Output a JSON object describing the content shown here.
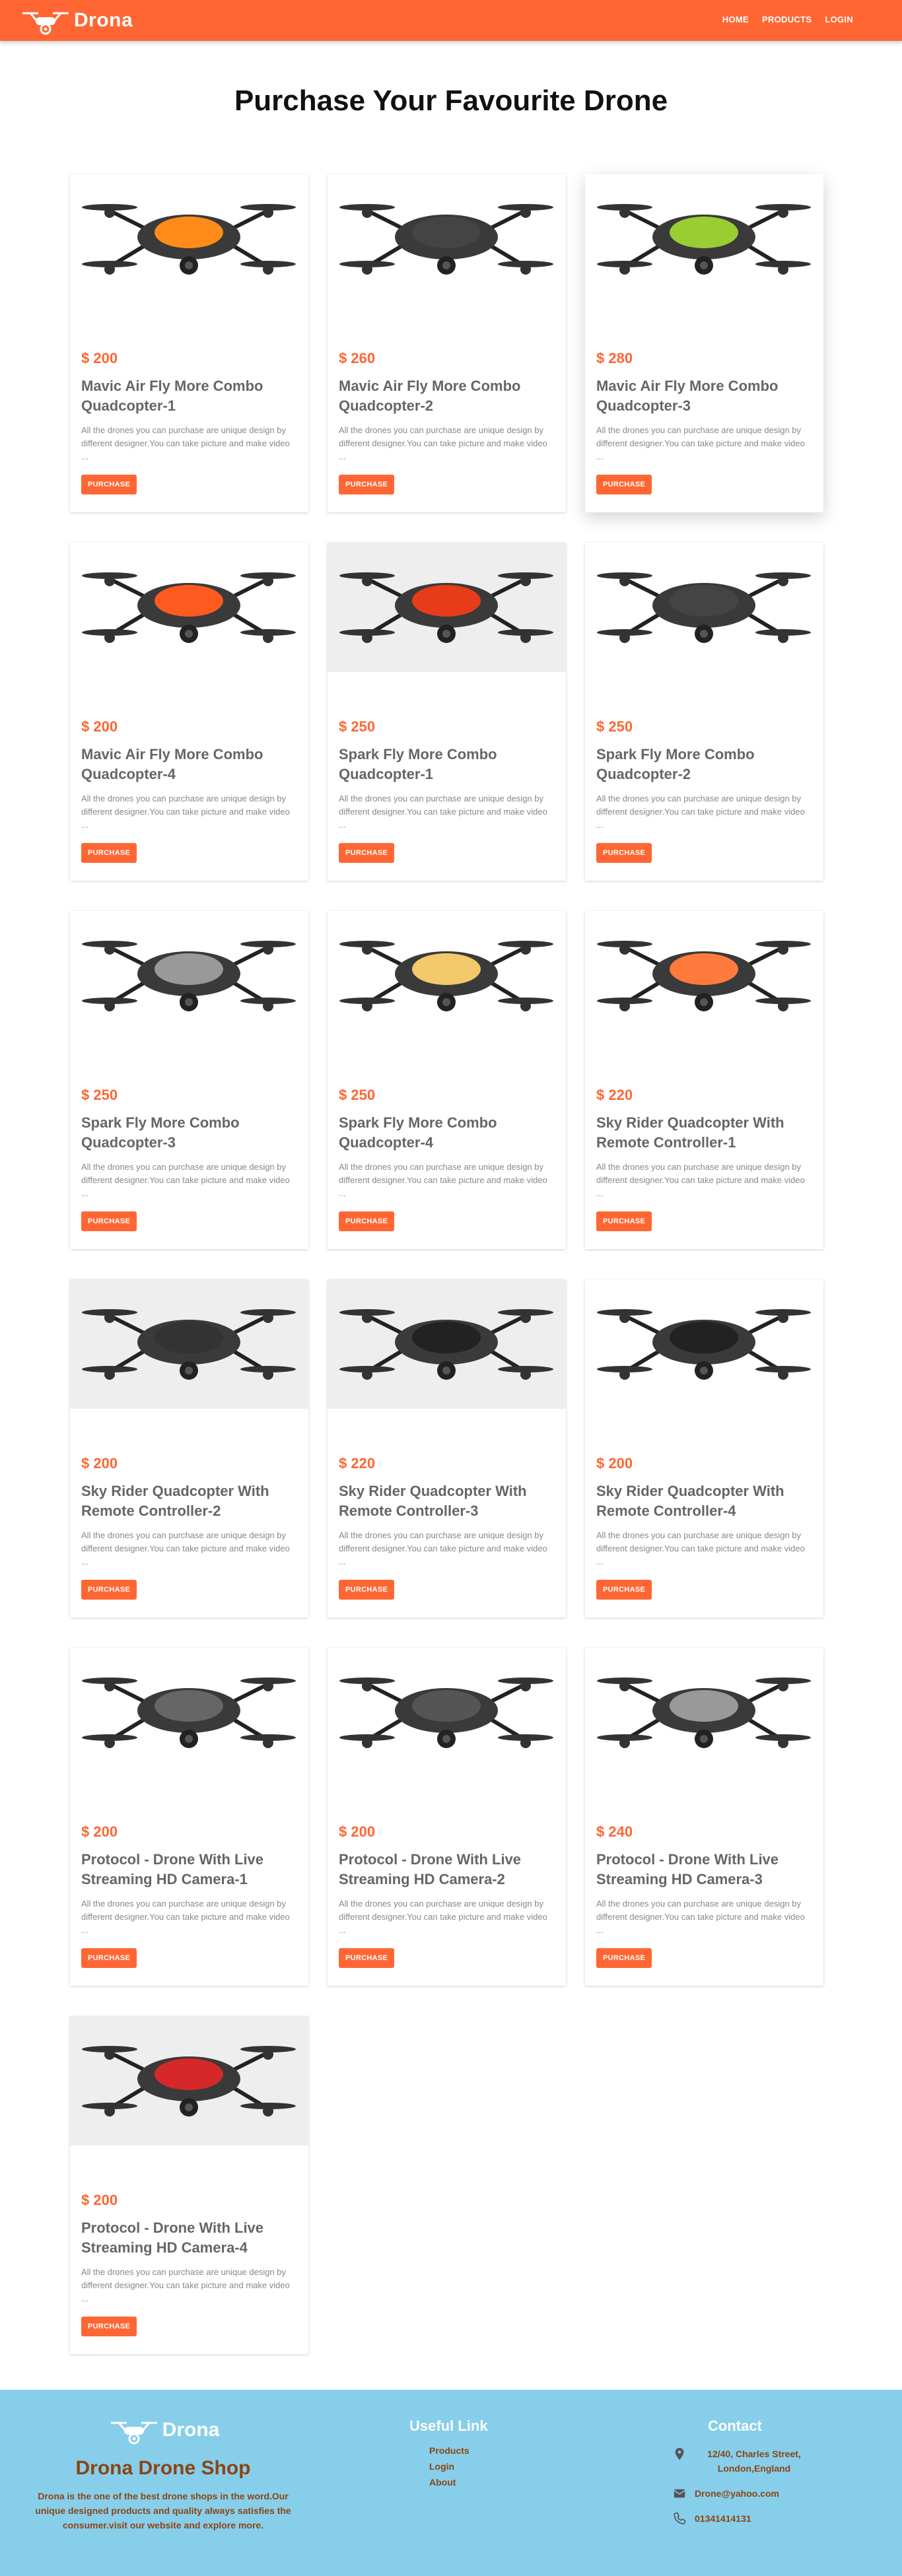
{
  "nav": {
    "brand": "Drona",
    "links": [
      "HOME",
      "PRODUCTS",
      "LOGIN"
    ]
  },
  "page": {
    "title": "Purchase Your Favourite Drone"
  },
  "description": "All the drones you can purchase are unique design by different designer.You can take picture and make video ...",
  "purchase_label": "PURCHASE",
  "products": [
    {
      "price": "$ 200",
      "name": "Mavic Air Fly More Combo Quadcopter-1"
    },
    {
      "price": "$ 260",
      "name": "Mavic Air Fly More Combo Quadcopter-2"
    },
    {
      "price": "$ 280",
      "name": "Mavic Air Fly More Combo Quadcopter-3"
    },
    {
      "price": "$ 200",
      "name": "Mavic Air Fly More Combo Quadcopter-4"
    },
    {
      "price": "$ 250",
      "name": "Spark Fly More Combo Quadcopter-1"
    },
    {
      "price": "$ 250",
      "name": "Spark Fly More Combo Quadcopter-2"
    },
    {
      "price": "$ 250",
      "name": "Spark Fly More Combo Quadcopter-3"
    },
    {
      "price": "$ 250",
      "name": "Spark Fly More Combo Quadcopter-4"
    },
    {
      "price": "$ 220",
      "name": "Sky Rider Quadcopter With Remote Controller-1"
    },
    {
      "price": "$ 200",
      "name": "Sky Rider Quadcopter With Remote Controller-2"
    },
    {
      "price": "$ 220",
      "name": "Sky Rider Quadcopter With Remote Controller-3"
    },
    {
      "price": "$ 200",
      "name": "Sky Rider Quadcopter With Remote Controller-4"
    },
    {
      "price": "$ 200",
      "name": "Protocol - Drone With Live Streaming HD Camera-1"
    },
    {
      "price": "$ 200",
      "name": "Protocol - Drone With Live Streaming HD Camera-2"
    },
    {
      "price": "$ 240",
      "name": "Protocol - Drone With Live Streaming HD Camera-3"
    },
    {
      "price": "$ 200",
      "name": "Protocol - Drone With Live Streaming HD Camera-4"
    }
  ],
  "footer": {
    "brand": "Drona",
    "shop_name": "Drona Drone Shop",
    "about": "Drona is the one of the best drone shops in the word.Our unique designed products and quality always satisfies the consumer.visit our website and explore more.",
    "useful_heading": "Useful Link",
    "useful_links": [
      "Products",
      "Login",
      "About"
    ],
    "contact_heading": "Contact",
    "address": "12/40, Charles Street, London,England",
    "email": "Drone@yahoo.com",
    "phone": "01341414131"
  },
  "colors": {
    "accent": "#ff6633",
    "footer_bg": "#87ceeb",
    "footer_text": "#8b4513"
  }
}
